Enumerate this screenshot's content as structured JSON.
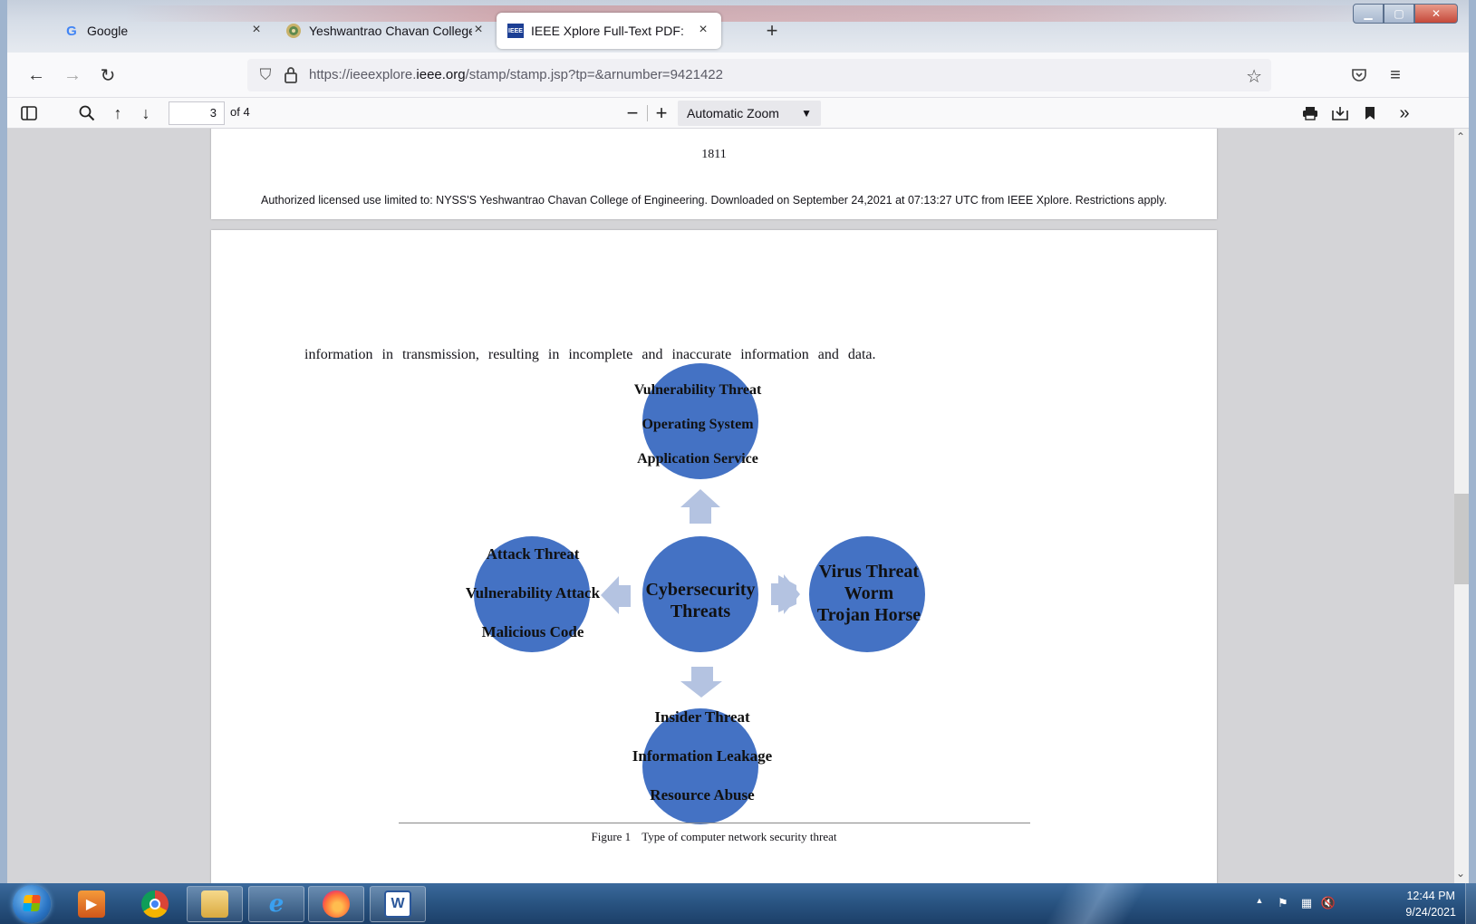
{
  "browser": {
    "tabs": [
      {
        "title": "Google",
        "favicon": "G"
      },
      {
        "title": "Yeshwantrao Chavan College of E",
        "favicon": "college-crest"
      },
      {
        "title": "IEEE Xplore Full-Text PDF:",
        "favicon": "IEEE"
      }
    ],
    "new_tab_label": "+",
    "close_label": "×",
    "url_prefix": "https://ieeexplore.",
    "url_domain": "ieee.org",
    "url_path": "/stamp/stamp.jsp?tp=&arnumber=9421422"
  },
  "pdf_toolbar": {
    "page_number": "3",
    "page_of": "of 4",
    "zoom": "Automatic Zoom"
  },
  "document": {
    "page_number": "1811",
    "license": "Authorized licensed use limited to: NYSS'S Yeshwantrao Chavan College of Engineering. Downloaded on September 24,2021 at 07:13:27 UTC from IEEE Xplore.  Restrictions apply.",
    "body_text": "information   in   transmission,   resulting   in   incomplete   and      inaccurate information and data.",
    "figure": {
      "center": [
        "Cybersecurity",
        "Threats"
      ],
      "top": [
        "Vulnerability Threat",
        "Operating System",
        "Application Service"
      ],
      "left": [
        "Attack Threat",
        "Vulnerability Attack",
        "Malicious Code"
      ],
      "right": [
        "Virus Threat",
        "Worm",
        "Trojan Horse"
      ],
      "bottom": [
        "Insider Threat",
        "Information Leakage",
        "Resource Abuse"
      ],
      "caption_label": "Figure 1",
      "caption_text": "Type of computer network security threat"
    }
  },
  "taskbar": {
    "apps": [
      "media-player",
      "chrome",
      "file-explorer",
      "internet-explorer",
      "firefox",
      "word"
    ],
    "clock_time": "12:44 PM",
    "clock_date": "9/24/2021"
  },
  "colors": {
    "circle": "#4472c4",
    "arrow": "#b4c3e1"
  }
}
